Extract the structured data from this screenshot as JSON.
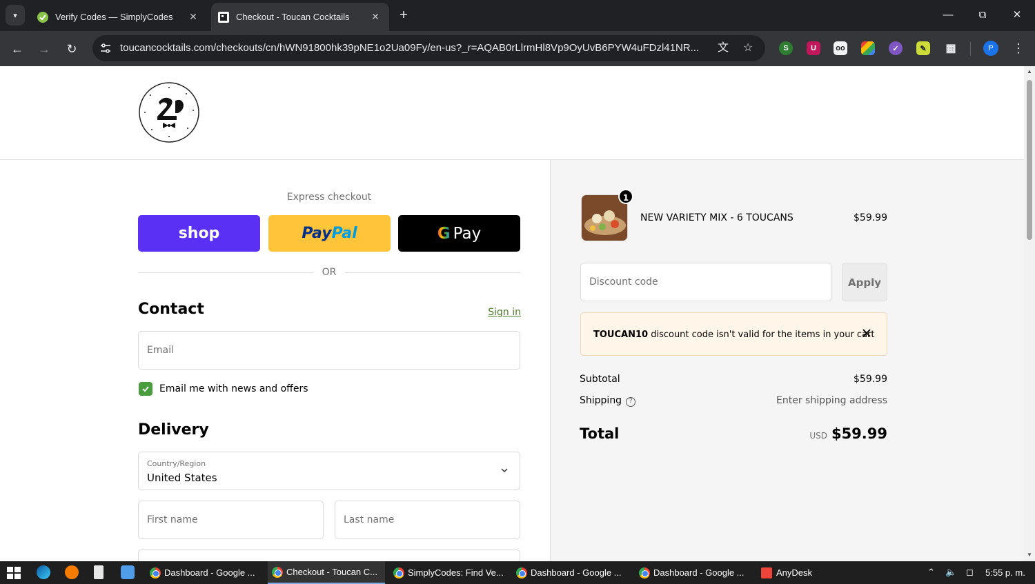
{
  "browser": {
    "tabs": [
      {
        "title": "Verify Codes — SimplyCodes",
        "active": false
      },
      {
        "title": "Checkout - Toucan Cocktails",
        "active": true
      }
    ],
    "url": "toucancocktails.com/checkouts/cn/hWN91800hk39pNE1o2Ua09Fy/en-us?_r=AQAB0rLlrmHl8Vp9OyUvB6PYW4uFDzl41NR..."
  },
  "checkout": {
    "express_title": "Express checkout",
    "payment_buttons": {
      "shop": "shop",
      "paypal_a": "Pay",
      "paypal_b": "Pal",
      "gpay_g": "G",
      "gpay_text": "Pay"
    },
    "or_text": "OR",
    "contact": {
      "heading": "Contact",
      "sign_in": "Sign in",
      "email_placeholder": "Email",
      "news_label": "Email me with news and offers",
      "news_checked": true
    },
    "delivery": {
      "heading": "Delivery",
      "country_label": "Country/Region",
      "country_value": "United States",
      "first_name_placeholder": "First name",
      "last_name_placeholder": "Last name"
    }
  },
  "summary": {
    "product": {
      "name": "NEW VARIETY MIX - 6 TOUCANS",
      "price": "$59.99",
      "quantity": "1"
    },
    "discount_placeholder": "Discount code",
    "apply_label": "Apply",
    "alert": {
      "code": "TOUCAN10",
      "message": "discount code isn't valid for the items in your cart"
    },
    "subtotal_label": "Subtotal",
    "subtotal_value": "$59.99",
    "shipping_label": "Shipping",
    "shipping_value": "Enter shipping address",
    "total_label": "Total",
    "total_currency": "USD",
    "total_value": "$59.99"
  },
  "taskbar": {
    "apps": [
      {
        "title": "Dashboard - Google ...",
        "active": false
      },
      {
        "title": "Checkout - Toucan C...",
        "active": true
      },
      {
        "title": "SimplyCodes: Find Ve...",
        "active": false
      },
      {
        "title": "Dashboard - Google ...",
        "active": false
      },
      {
        "title": "Dashboard - Google ...",
        "active": false
      },
      {
        "title": "AnyDesk",
        "active": false
      }
    ],
    "time": "5:55 p. m."
  },
  "colors": {
    "shop": "#5a31f4",
    "paypal": "#ffc439",
    "gpay": "#000000",
    "accent_green": "#4a9d3f",
    "alert_bg": "#fff5e9"
  }
}
